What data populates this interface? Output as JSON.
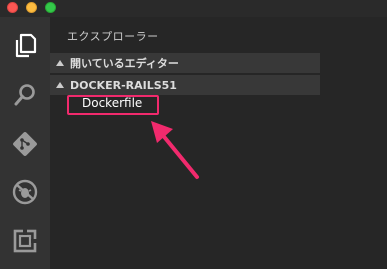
{
  "window": {
    "title_bar": {
      "buttons": [
        "close",
        "minimize",
        "maximize"
      ]
    }
  },
  "activity_bar": {
    "items": [
      {
        "name": "explorer",
        "icon": "files-icon",
        "active": true
      },
      {
        "name": "search",
        "icon": "search-icon",
        "active": false
      },
      {
        "name": "source-control",
        "icon": "git-icon",
        "active": false
      },
      {
        "name": "debug",
        "icon": "debug-icon",
        "active": false
      },
      {
        "name": "extensions",
        "icon": "extensions-icon",
        "active": false
      }
    ]
  },
  "explorer": {
    "title": "エクスプローラー",
    "open_editors": {
      "label": "開いているエディター"
    },
    "project": {
      "label": "DOCKER-RAILS51",
      "files": [
        "Dockerfile"
      ]
    }
  },
  "annotation": {
    "highlight_color": "#f12a6d",
    "target": "Dockerfile"
  },
  "colors": {
    "activity_bar": "#333333",
    "sidebar": "#262626",
    "section_header": "#383838",
    "accent": "#f12a6d"
  }
}
